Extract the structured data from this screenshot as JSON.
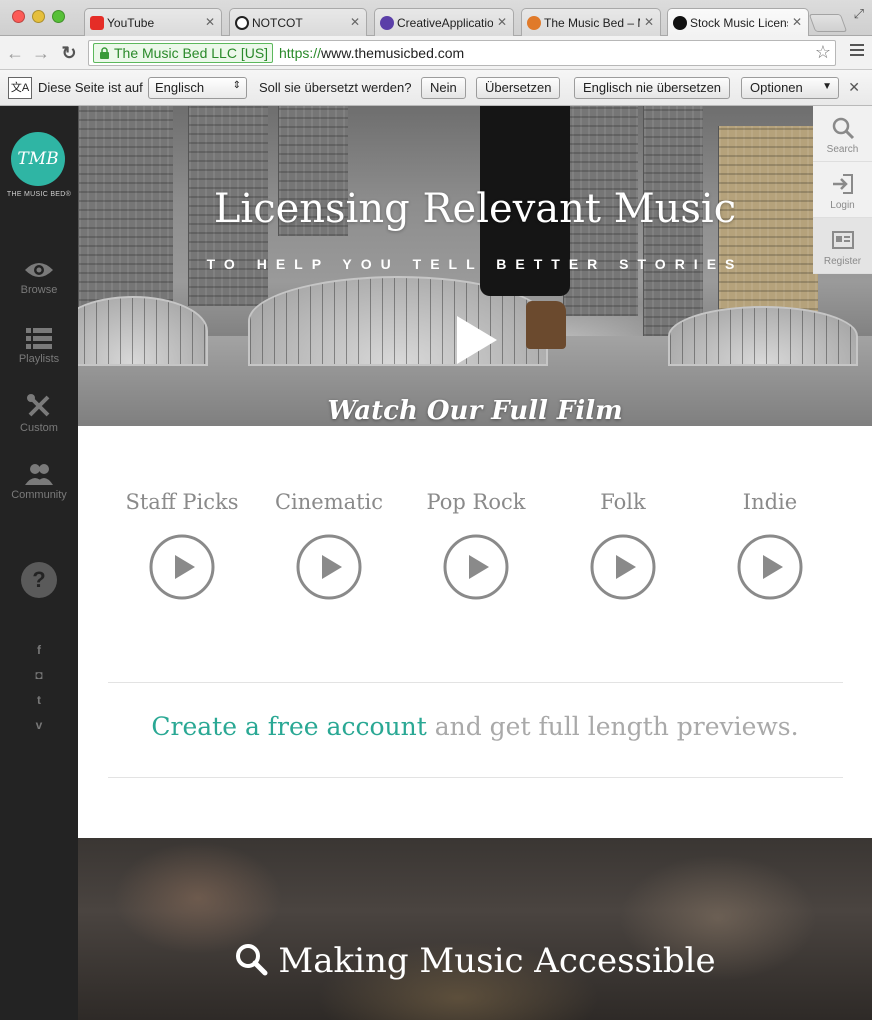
{
  "browser": {
    "tabs": [
      {
        "title": "YouTube",
        "favicon_color": "#e52d27"
      },
      {
        "title": "NOTCOT",
        "favicon_color": "#222222"
      },
      {
        "title": "CreativeApplicatio",
        "favicon_color": "#5b3fa8"
      },
      {
        "title": "The Music Bed – M",
        "favicon_color": "#e07a2a"
      },
      {
        "title": "Stock Music Licens",
        "favicon_color": "#111111"
      }
    ],
    "ev_cert": "The Music Bed LLC [US]",
    "url_scheme": "https://",
    "url_host": "www.themusicbed.com"
  },
  "translate_bar": {
    "prefix": "Diese Seite ist auf",
    "language": "Englisch",
    "question": "Soll sie übersetzt werden?",
    "no_label": "Nein",
    "translate_label": "Übersetzen",
    "never_label": "Englisch nie übersetzen",
    "options_label": "Optionen"
  },
  "sidebar": {
    "logo_mark": "TMB",
    "logo_text": "THE MUSIC BED®",
    "items": [
      {
        "label": "Browse",
        "icon": "eye-icon"
      },
      {
        "label": "Playlists",
        "icon": "list-icon"
      },
      {
        "label": "Custom",
        "icon": "tools-icon"
      },
      {
        "label": "Community",
        "icon": "people-icon"
      }
    ],
    "help": "?",
    "social": [
      {
        "glyph": "f",
        "icon": "facebook-icon"
      },
      {
        "glyph": "◘",
        "icon": "instagram-icon"
      },
      {
        "glyph": "t",
        "icon": "twitter-icon"
      },
      {
        "glyph": "v",
        "icon": "vimeo-icon"
      }
    ]
  },
  "util": {
    "search": "Search",
    "login": "Login",
    "register": "Register"
  },
  "hero": {
    "title": "Licensing Relevant Music",
    "subtitle": "TO HELP YOU TELL BETTER STORIES",
    "watch": "Watch Our Full Film"
  },
  "genres": [
    "Staff Picks",
    "Cinematic",
    "Pop Rock",
    "Folk",
    "Indie"
  ],
  "cta": {
    "link": "Create a free account",
    "rest": " and get full length previews."
  },
  "band": {
    "title": "Making Music Accessible"
  },
  "colors": {
    "accent": "#2aa894",
    "sidebar_bg": "#232323"
  }
}
